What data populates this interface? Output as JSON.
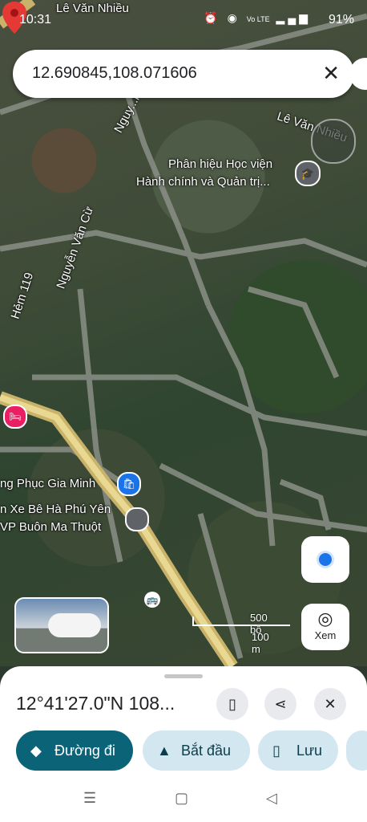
{
  "status_bar": {
    "time": "10:31",
    "battery": "91%",
    "network": "Vo LTE"
  },
  "search": {
    "query": "12.690845,108.071606"
  },
  "map_labels": {
    "le_van_nhieu_top": "Lê Văn Nhiều",
    "le_van_nhieu_right": "Lê Văn Nhiều",
    "nguyen_top": "Nguy...ng",
    "poi_academy_line1": "Phân hiệu Học viện",
    "poi_academy_line2": "Hành chính và Quản trị...",
    "nguyen_van_cu": "Nguyễn Văn Cừ",
    "hem_119": "Hẻm 119",
    "poi_shop": "ng Phục Gia Minh",
    "poi_car_line1": "n Xe Bê Hà Phú Yên",
    "poi_car_line2": "VP Buôn Ma Thuột"
  },
  "scale": {
    "imperial": "500 bộ",
    "metric": "100 m"
  },
  "side_buttons": {
    "street_view_label": "Xem"
  },
  "sheet": {
    "coordinates": "12°41'27.0\"N 108..."
  },
  "actions": [
    {
      "label": "Đường đi",
      "icon": "directions-icon"
    },
    {
      "label": "Bắt đầu",
      "icon": "navigation-arrow-icon"
    },
    {
      "label": "Lưu",
      "icon": "bookmark-icon"
    }
  ],
  "colors": {
    "primary": "#0b6378",
    "chip": "#d3e7f1",
    "pin": "#e53935"
  }
}
